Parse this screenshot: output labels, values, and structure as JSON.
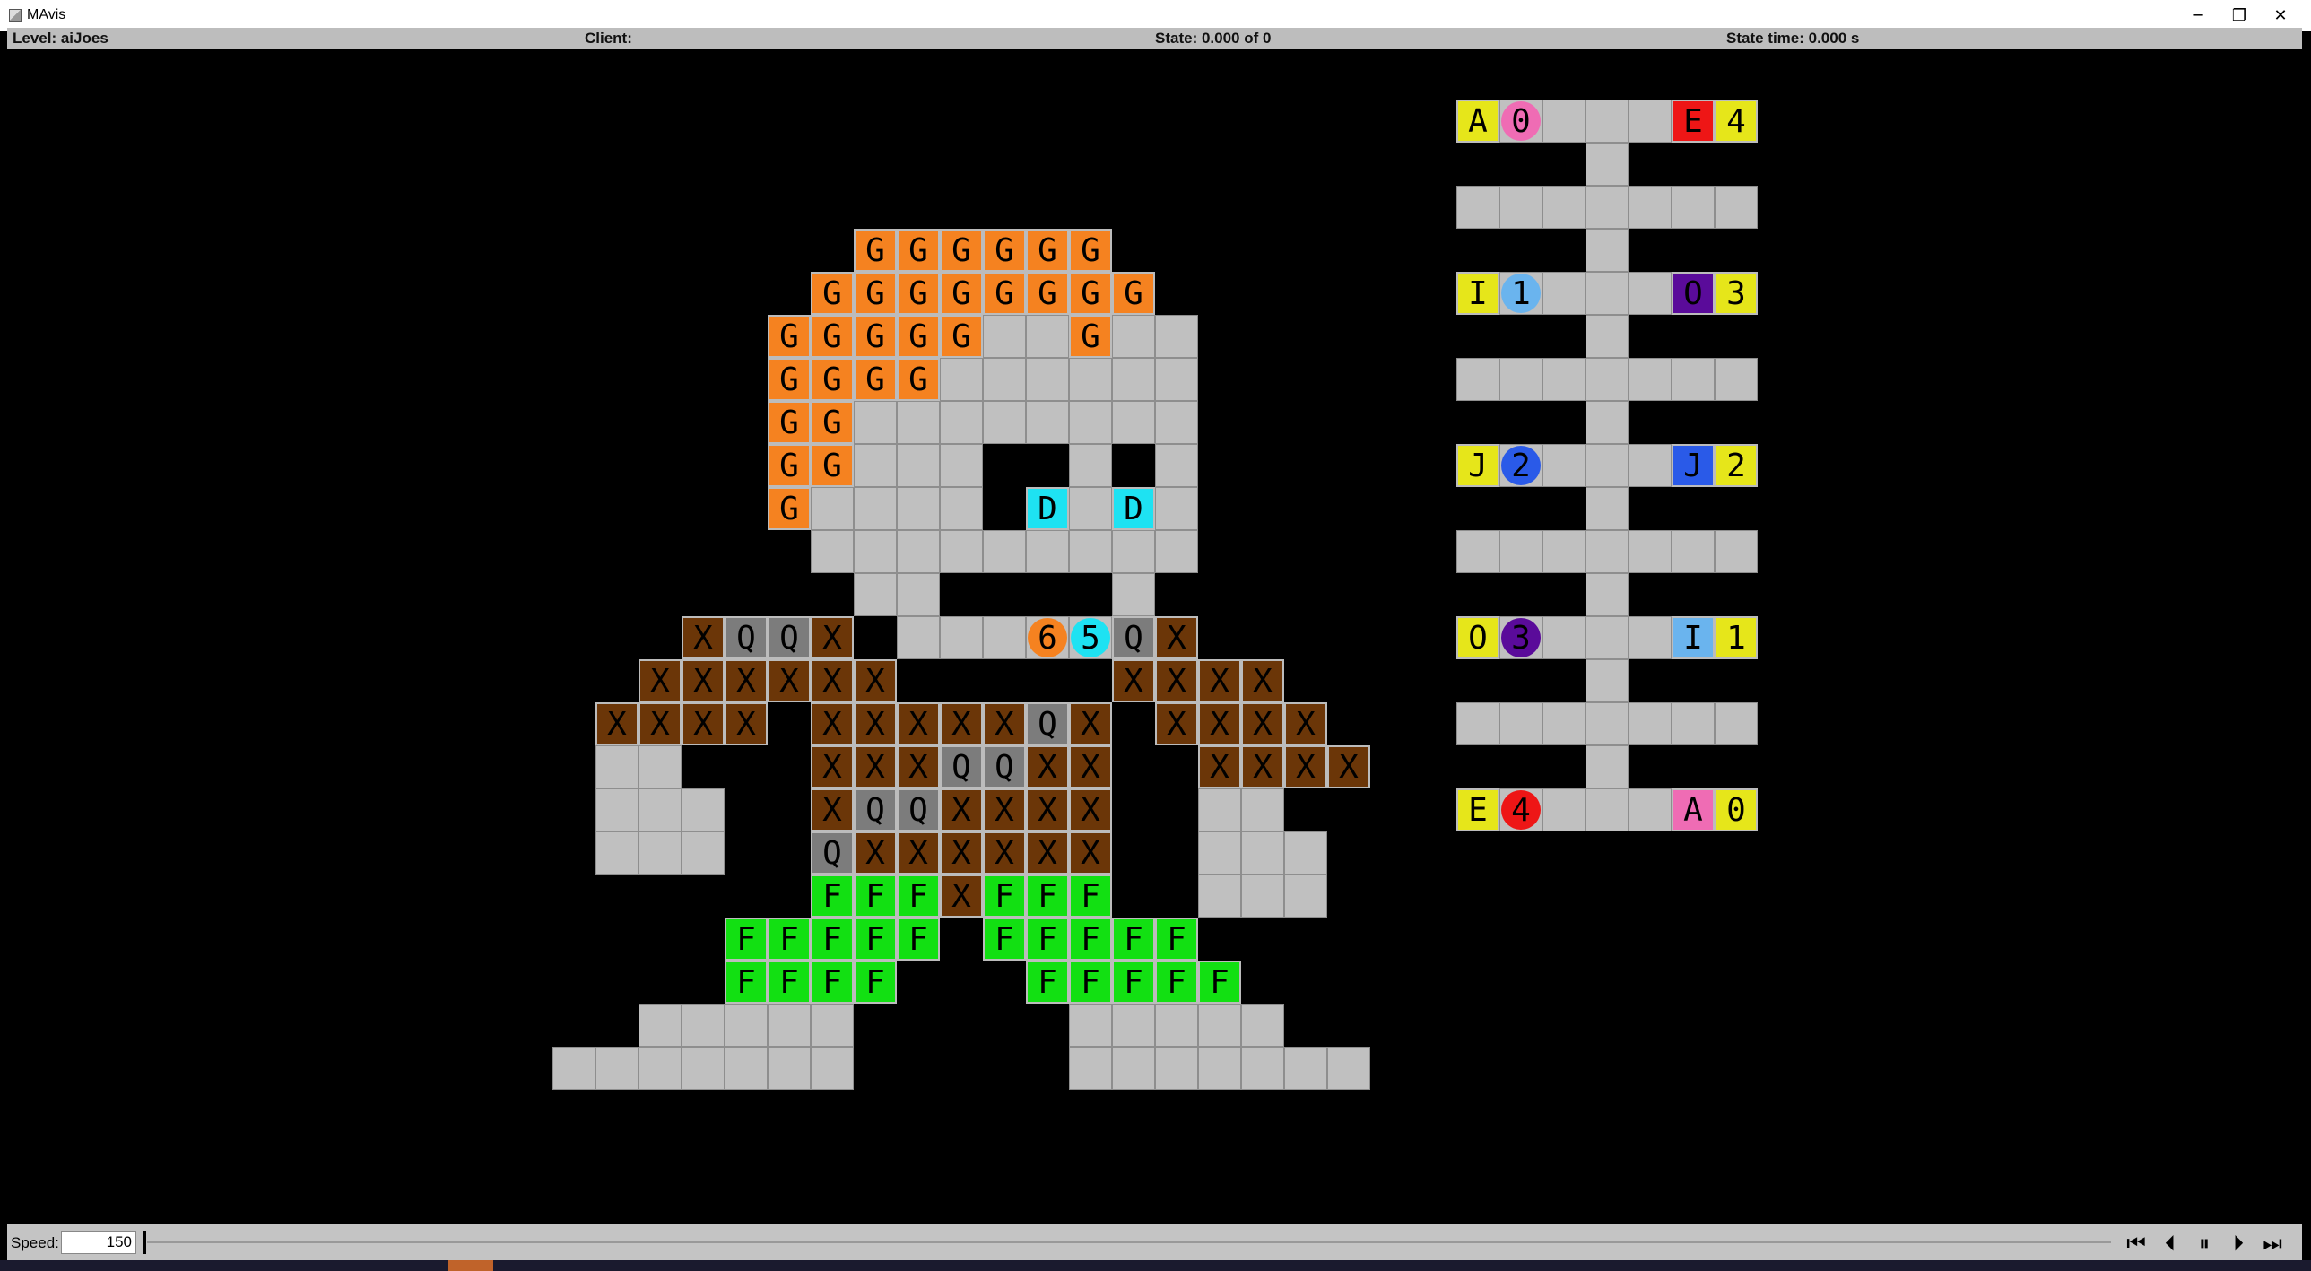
{
  "window": {
    "title": "MAvis",
    "minimize_glyph": "─",
    "restore_glyph": "❐",
    "close_glyph": "✕"
  },
  "infobar": {
    "level": "Level: aiJoes",
    "client": "Client:",
    "state": "State: 0.000 of 0",
    "state_time": "State time: 0.000 s"
  },
  "controls": {
    "speed_label": "Speed:",
    "speed_value": "150",
    "buttons": {
      "skip_start": "⏮",
      "step_back": "⏴",
      "pause": "⏸",
      "step_forward": "⏵",
      "skip_end": "⏭"
    }
  },
  "colors": {
    "floor": "#c0c0c0",
    "wall": "#000000",
    "orange": "#f58220",
    "cyan": "#1ee2f2",
    "brown": "#6b3608",
    "gray": "#7c7c7c",
    "green": "#12e012",
    "yellow": "#e6e61a",
    "pink": "#ef6cb4",
    "red": "#ee1616",
    "lightblue": "#6ab4ee",
    "purple": "#5a0b9a",
    "blue": "#2a5ae8"
  },
  "grid": {
    "floor_rows": [
      "                           ",
      "                    AAAAAAA",
      "                       A   ",
      "      AAAAAA        AAAAAAA",
      "     AAAAAAAA          A   ",
      "    AAAAAAAAA       AAAAAAA",
      "    AAAAAAAAA          A   ",
      "    AAAAAAAAA       AAAAAAA",
      "    AAAAA A A          A   ",
      "    AAAAAAAAA       AAAAAAA",
      "     AAAAAAAA          A   ",
      "      AA    A       AAAAAAA",
      "   AAAAAAAAAAAAA       A   ",
      "  AAAAAA AAAAAAAA   AAAAAAA",
      " AAAAAAAAAAAAAAAA      A   ",
      " AA  AAAAAAAAAAAAA  AAAAAAA",
      " AAA AAAAAAA AA          A   ",
      " AAA AAAAAAA AAA   AAAAAAA",
      "    AAAAAAA  AAA      A   ",
      "   AAAAA AAAAA     AAAAAAA",
      "   AAAA  AAAAA        A   ",
      "  AAAAA  AAAAA     AAAAAAA",
      "AAAAAAA  AAAAAAA      A   ",
      "                   AAAAAAA"
    ],
    "boxes": [
      {
        "r": 1,
        "c": 20,
        "ch": "A",
        "color": "yellow"
      },
      {
        "r": 1,
        "c": 25,
        "ch": "E",
        "color": "red"
      },
      {
        "r": 5,
        "c": 20,
        "ch": "I",
        "color": "yellow"
      },
      {
        "r": 5,
        "c": 25,
        "ch": "O",
        "color": "purple"
      },
      {
        "r": 9,
        "c": 20,
        "ch": "J",
        "color": "yellow"
      },
      {
        "r": 9,
        "c": 25,
        "ch": "J",
        "color": "blue"
      },
      {
        "r": 13,
        "c": 20,
        "ch": "O",
        "color": "yellow"
      },
      {
        "r": 13,
        "c": 25,
        "ch": "I",
        "color": "lightblue"
      },
      {
        "r": 17,
        "c": 20,
        "ch": "E",
        "color": "yellow"
      },
      {
        "r": 17,
        "c": 25,
        "ch": "A",
        "color": "pink"
      }
    ],
    "goal_cells_right": [
      {
        "r": 1,
        "c": 26,
        "ch": "4",
        "color": "yellow"
      },
      {
        "r": 5,
        "c": 26,
        "ch": "3",
        "color": "yellow"
      },
      {
        "r": 9,
        "c": 26,
        "ch": "2",
        "color": "yellow"
      },
      {
        "r": 13,
        "c": 26,
        "ch": "1",
        "color": "yellow"
      },
      {
        "r": 17,
        "c": 26,
        "ch": "0",
        "color": "yellow"
      }
    ],
    "agents_right": [
      {
        "r": 1,
        "c": 21,
        "ch": "0",
        "color": "pink"
      },
      {
        "r": 5,
        "c": 21,
        "ch": "1",
        "color": "lightblue"
      },
      {
        "r": 9,
        "c": 21,
        "ch": "2",
        "color": "blue"
      },
      {
        "r": 13,
        "c": 21,
        "ch": "3",
        "color": "purple"
      },
      {
        "r": 17,
        "c": 21,
        "ch": "4",
        "color": "red"
      }
    ]
  },
  "left_map": {
    "G_cells": [
      [
        3,
        7
      ],
      [
        3,
        8
      ],
      [
        3,
        9
      ],
      [
        3,
        10
      ],
      [
        3,
        11
      ],
      [
        3,
        12
      ],
      [
        4,
        6
      ],
      [
        4,
        7
      ],
      [
        4,
        8
      ],
      [
        4,
        9
      ],
      [
        4,
        10
      ],
      [
        4,
        11
      ],
      [
        4,
        12
      ],
      [
        4,
        13
      ],
      [
        5,
        5
      ],
      [
        5,
        6
      ],
      [
        5,
        7
      ],
      [
        5,
        8
      ],
      [
        5,
        9
      ],
      [
        5,
        12
      ],
      [
        6,
        5
      ],
      [
        6,
        6
      ],
      [
        6,
        7
      ],
      [
        6,
        8
      ],
      [
        7,
        5
      ],
      [
        7,
        6
      ],
      [
        8,
        5
      ],
      [
        8,
        6
      ],
      [
        9,
        5
      ]
    ],
    "G_letter": "G",
    "D_cells": [
      [
        9,
        11
      ],
      [
        9,
        13
      ]
    ],
    "D_letter": "D",
    "X_cells": [
      [
        12,
        3
      ],
      [
        12,
        6
      ],
      [
        12,
        14
      ],
      [
        13,
        2
      ],
      [
        13,
        3
      ],
      [
        13,
        4
      ],
      [
        13,
        5
      ],
      [
        13,
        6
      ],
      [
        13,
        7
      ],
      [
        13,
        13
      ],
      [
        13,
        14
      ],
      [
        13,
        15
      ],
      [
        13,
        16
      ],
      [
        14,
        1
      ],
      [
        14,
        2
      ],
      [
        14,
        3
      ],
      [
        14,
        4
      ],
      [
        14,
        6
      ],
      [
        14,
        7
      ],
      [
        14,
        8
      ],
      [
        14,
        9
      ],
      [
        14,
        10
      ],
      [
        14,
        12
      ],
      [
        14,
        14
      ],
      [
        14,
        15
      ],
      [
        14,
        16
      ],
      [
        14,
        17
      ],
      [
        15,
        6
      ],
      [
        15,
        7
      ],
      [
        15,
        8
      ],
      [
        15,
        11
      ],
      [
        15,
        12
      ],
      [
        15,
        15
      ],
      [
        15,
        16
      ],
      [
        15,
        17
      ],
      [
        15,
        18
      ],
      [
        16,
        6
      ],
      [
        16,
        9
      ],
      [
        16,
        10
      ],
      [
        16,
        11
      ],
      [
        16,
        12
      ],
      [
        17,
        7
      ],
      [
        17,
        8
      ],
      [
        17,
        9
      ],
      [
        17,
        10
      ],
      [
        17,
        11
      ],
      [
        17,
        12
      ],
      [
        18,
        9
      ]
    ],
    "X_letter": "X",
    "Q_cells": [
      [
        12,
        4
      ],
      [
        12,
        5
      ],
      [
        12,
        13
      ],
      [
        14,
        11
      ],
      [
        15,
        9
      ],
      [
        15,
        10
      ],
      [
        16,
        7
      ],
      [
        16,
        8
      ],
      [
        17,
        6
      ]
    ],
    "Q_letter": "Q",
    "F_cells": [
      [
        18,
        6
      ],
      [
        18,
        7
      ],
      [
        18,
        8
      ],
      [
        18,
        10
      ],
      [
        18,
        11
      ],
      [
        18,
        12
      ],
      [
        19,
        4
      ],
      [
        19,
        5
      ],
      [
        19,
        6
      ],
      [
        19,
        7
      ],
      [
        19,
        8
      ],
      [
        19,
        10
      ],
      [
        19,
        11
      ],
      [
        19,
        12
      ],
      [
        19,
        13
      ],
      [
        19,
        14
      ],
      [
        20,
        4
      ],
      [
        20,
        5
      ],
      [
        20,
        6
      ],
      [
        20,
        7
      ],
      [
        20,
        11
      ],
      [
        20,
        12
      ],
      [
        20,
        13
      ],
      [
        20,
        14
      ],
      [
        20,
        15
      ]
    ],
    "F_letter": "F",
    "agents": [
      {
        "r": 12,
        "c": 11,
        "ch": "6",
        "color": "orange"
      },
      {
        "r": 12,
        "c": 12,
        "ch": "5",
        "color": "cyan"
      }
    ]
  }
}
